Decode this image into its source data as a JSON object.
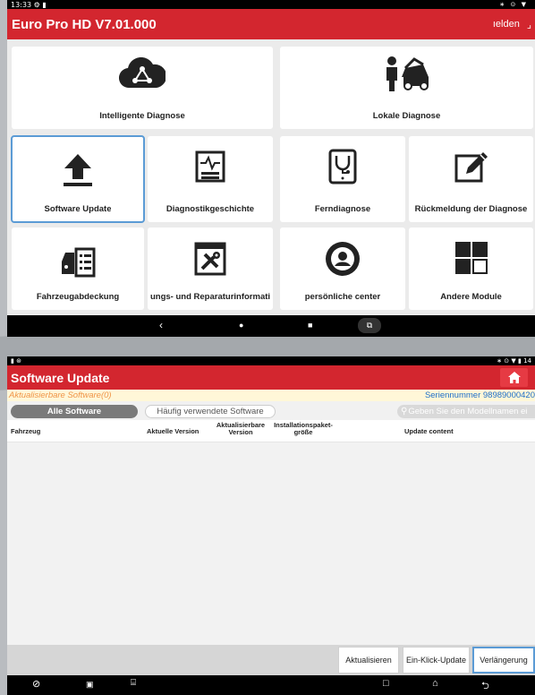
{
  "screen1": {
    "status_time": "13:33",
    "status_left_icons": "⚙ ▮",
    "status_right_icons": "∗ ⊙ ▼",
    "title": "Euro Pro HD V7.01.000",
    "header_right": "ıelden",
    "tiles": [
      {
        "label": "Intelligente Diagnose",
        "icon": "cloud-share-icon"
      },
      {
        "label": "Lokale Diagnose",
        "icon": "mechanic-car-icon"
      },
      {
        "label": "Software Update",
        "icon": "upload-arrow-icon"
      },
      {
        "label": "Diagnostikgeschichte",
        "icon": "waveform-report-icon"
      },
      {
        "label": "Ferndiagnose",
        "icon": "stethoscope-tablet-icon"
      },
      {
        "label": "Rückmeldung der Diagnose",
        "icon": "edit-pencil-icon"
      },
      {
        "label": "Fahrzeugabdeckung",
        "icon": "car-list-icon"
      },
      {
        "label": "ungs- und Reparaturinformati",
        "icon": "tools-icon"
      },
      {
        "label": "persönliche center",
        "icon": "user-circle-icon"
      },
      {
        "label": "Andere Module",
        "icon": "modules-grid-icon"
      }
    ],
    "nav": {
      "back": "‹",
      "home": "●",
      "recent": "■"
    }
  },
  "screen2": {
    "status_right": "∗ ⊙ ▼ ▮ 14",
    "title": "Software Update",
    "updatable_label": "Aktualisierbare Software(0)",
    "serial": "Seriennummer 98989000420",
    "filter_all": "Alle Software",
    "filter_frequent": "Häufig verwendete Software",
    "search_placeholder": "Geben Sie den Modellnamen ei",
    "columns": {
      "vehicle": "Fahrzeug",
      "current_version": "Aktuelle Version",
      "updatable_version": "Aktualisierbare Version",
      "package_size": "Installationspaket- größe",
      "update_content": "Update content"
    },
    "buttons": {
      "refresh": "Aktualisieren",
      "one_click": "Ein-Klick-Update",
      "extend": "Verlängerung"
    }
  },
  "colors": {
    "brand_red": "#d3262f",
    "selection_blue": "#5b9bd5",
    "serial_blue": "#1f6fc8",
    "updatable_orange": "#f09447"
  }
}
